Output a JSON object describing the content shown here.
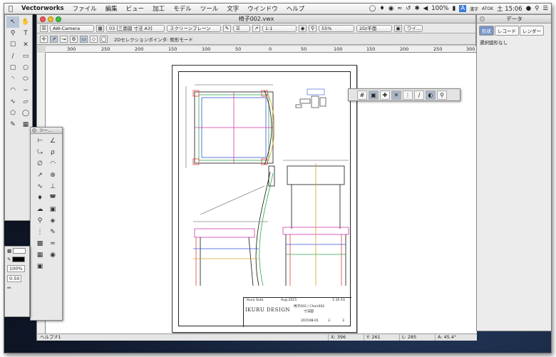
{
  "menubar": {
    "apple": "",
    "app_name": "Vectorworks",
    "menus": [
      "ファイル",
      "編集",
      "ビュー",
      "加工",
      "モデル",
      "ツール",
      "文字",
      "ウインドウ",
      "ヘルプ"
    ],
    "battery": "100%",
    "input_method": "漢字",
    "atok": "ATOK",
    "clock": "土 15:06"
  },
  "window": {
    "title": "椅子002.vwx",
    "toolbar1": {
      "class": "AW-Camera",
      "layer": "03 [三面図 寸法 A3]",
      "render_mode": "スクリーンプレーン",
      "scale": "1:1",
      "zoom": "55%",
      "view": "2D/平面",
      "projection": "ワイ…"
    },
    "toolbar2": {
      "message": "2Dセレクションポインタ: 矩形モード"
    },
    "ruler_h": [
      "300",
      "250",
      "200",
      "150",
      "100",
      "50",
      "0",
      "50",
      "100",
      "150",
      "200",
      "250",
      "300"
    ],
    "status": {
      "help": "ヘルプ:F1",
      "x": "X: 396",
      "y": "Y: 261",
      "l": "L: 285",
      "a": "A: 45.4°"
    }
  },
  "titleblock": {
    "designer": "Ikuru Suto",
    "date": "Aug 2015",
    "sheet_size": "1:10 A3",
    "title": "椅子002 / Chair002",
    "subtitle": "寸法図",
    "brand": "IKURU DESIGN",
    "drawing_no": "201508-01",
    "num_a": "3",
    "num_b": "3"
  },
  "tool_palette_title": "ツー…",
  "attr_palette": {
    "opacity": "100%",
    "line_weight": "0.50"
  },
  "data_palette": {
    "title": "データ",
    "tabs": [
      "形状",
      "レコード",
      "レンダー"
    ],
    "selection": "選択図形なし"
  },
  "colors": {
    "menubar": "#ececec",
    "window_chrome": "#d8d8d8",
    "selection_blue": "#b9c6d8",
    "desktop": "#101a30"
  }
}
